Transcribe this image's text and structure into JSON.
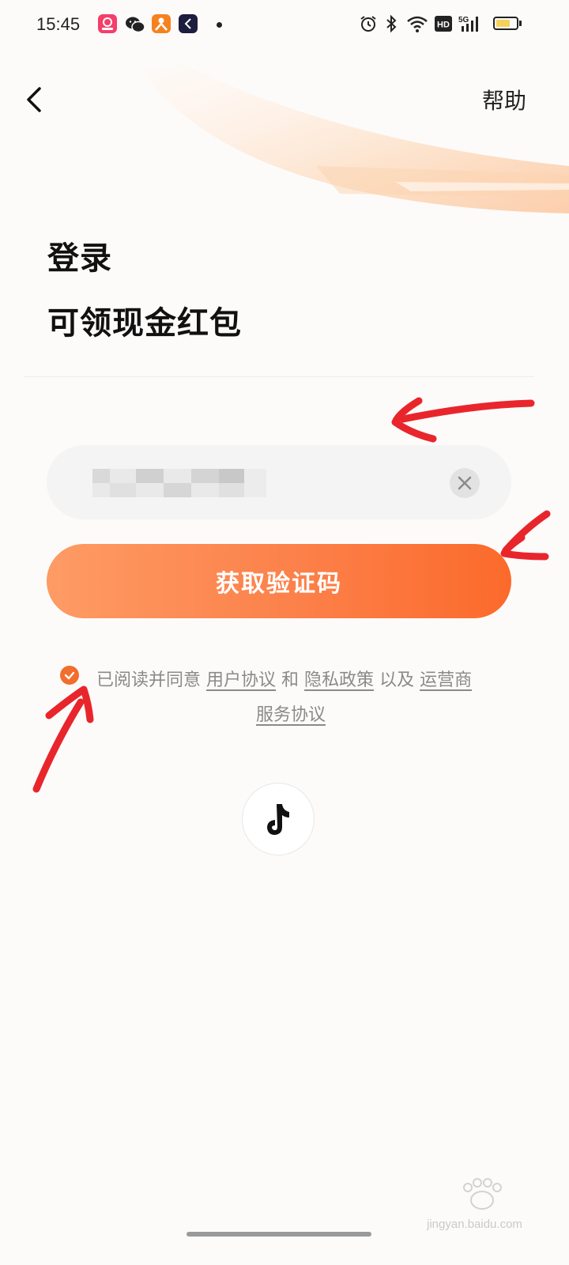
{
  "status_bar": {
    "time": "15:45",
    "apps": [
      "pink-app-icon",
      "wechat-icon",
      "orange-app-icon",
      "navy-app-icon"
    ],
    "indicators": [
      "alarm-icon",
      "bluetooth-icon",
      "wifi-icon",
      "hd-icon",
      "5g-signal-icon",
      "battery-icon"
    ],
    "battery_level": 0.7
  },
  "header": {
    "back_icon": "chevron-left-icon",
    "help_label": "帮助"
  },
  "titles": {
    "line1": "登录",
    "line2": "可领现金红包"
  },
  "phone_input": {
    "clear_icon": "close-icon"
  },
  "get_code_button": {
    "label": "获取验证码"
  },
  "agreement": {
    "checked": true,
    "prefix": "已阅读并同意",
    "user_agreement": "用户协议",
    "and": "和",
    "privacy_policy": "隐私政策",
    "also": "以及",
    "operator_part1": "运营商",
    "operator_part2": "服务协议"
  },
  "third_party_login": {
    "icon": "tiktok-icon"
  },
  "watermark": {
    "text": "jingyan.baidu.com"
  },
  "colors": {
    "accent": "#fb6a2b",
    "accent_light": "#fe9b65",
    "annotation_red": "#e8131b"
  }
}
